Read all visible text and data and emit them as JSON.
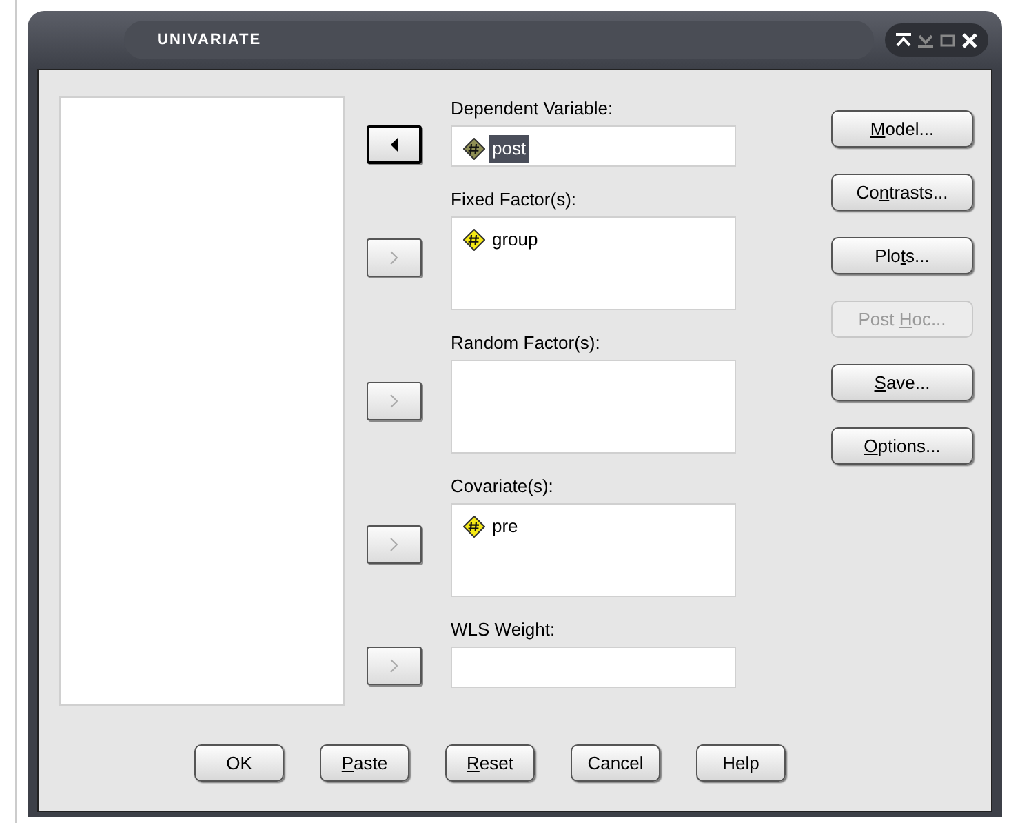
{
  "window": {
    "title": "UNIVARIATE"
  },
  "targets": [
    {
      "label": "Dependent Variable:",
      "kind": "field",
      "arrow": {
        "kind": "left",
        "disabled": false,
        "active": true
      },
      "items": [
        {
          "name": "post",
          "selected": true
        }
      ]
    },
    {
      "label": "Fixed Factor(s):",
      "kind": "list",
      "arrow": {
        "kind": "right",
        "disabled": true,
        "active": false
      },
      "items": [
        {
          "name": "group",
          "selected": false
        }
      ]
    },
    {
      "label": "Random Factor(s):",
      "kind": "list",
      "arrow": {
        "kind": "right",
        "disabled": true,
        "active": false
      }
    },
    {
      "label": "Covariate(s):",
      "kind": "list",
      "arrow": {
        "kind": "right",
        "disabled": true,
        "active": false
      },
      "items": [
        {
          "name": "pre",
          "selected": false
        }
      ]
    },
    {
      "label": "WLS Weight:",
      "kind": "field",
      "arrow": {
        "kind": "right",
        "disabled": true,
        "active": false
      }
    }
  ],
  "side_buttons": [
    {
      "key": "M",
      "post": "odel...",
      "disabled": false
    },
    {
      "pre": "Co",
      "key": "n",
      "post": "trasts...",
      "disabled": false
    },
    {
      "pre": "Plo",
      "key": "t",
      "post": "s...",
      "disabled": false
    },
    {
      "pre": "Post ",
      "key": "H",
      "post": "oc...",
      "disabled": true
    },
    {
      "key": "S",
      "post": "ave...",
      "disabled": false
    },
    {
      "key": "O",
      "post": "ptions...",
      "disabled": false
    }
  ],
  "bottom_buttons": [
    {
      "pre": "OK",
      "disabled": false
    },
    {
      "key": "P",
      "post": "aste",
      "disabled": false
    },
    {
      "key": "R",
      "post": "eset",
      "disabled": false
    },
    {
      "pre": "Cancel",
      "disabled": false
    },
    {
      "pre": "Help",
      "disabled": false
    }
  ]
}
